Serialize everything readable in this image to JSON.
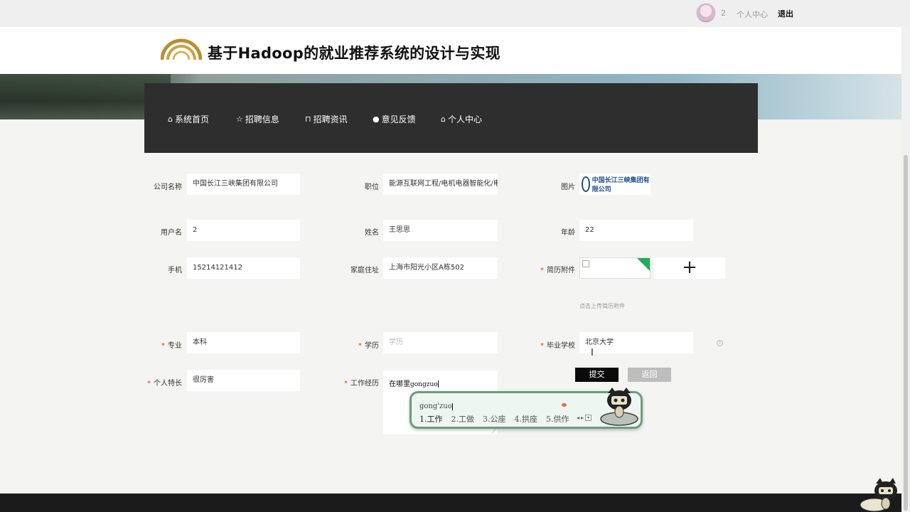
{
  "topbar": {
    "username": "2",
    "personal_center": "个人中心",
    "logout": "退出"
  },
  "header": {
    "title": "基于Hadoop的就业推荐系统的设计与实现"
  },
  "nav": {
    "items": [
      {
        "label": "系统首页",
        "icon": "home-icon"
      },
      {
        "label": "招聘信息",
        "icon": "star-icon"
      },
      {
        "label": "招聘资讯",
        "icon": "bag-icon"
      },
      {
        "label": "意见反馈",
        "icon": "alert-circle-icon"
      },
      {
        "label": "个人中心",
        "icon": "home-icon"
      }
    ]
  },
  "form": {
    "company_name_label": "公司名称",
    "company_name": "中国长江三峡集团有限公司",
    "position_label": "职位",
    "position": "能源互联网工程/电机电器智能化/电",
    "image_label": "图片",
    "company_logo_text": "中国长江三峡集团有限公司",
    "username_label": "用户名",
    "username": "2",
    "name_label": "姓名",
    "name": "王思思",
    "age_label": "年龄",
    "age": "22",
    "phone_label": "手机",
    "phone": "15214121412",
    "address_label": "家庭住址",
    "address": "上海市阳光小区A栋502",
    "resume_label": "简历附件",
    "upload_hint": "点击上传简历附件",
    "major_label": "专业",
    "major": "本科",
    "education_label": "学历",
    "education_placeholder": "学历",
    "school_label": "毕业学校",
    "school": "北京大学",
    "specialty_label": "个人特长",
    "specialty": "很厉害",
    "experience_label": "工作经历",
    "experience_text": "在哪里",
    "experience_composing": "gongzuo",
    "submit": "提交",
    "back": "返回"
  },
  "ime": {
    "pinyin": "gong'zuo",
    "candidates": [
      "1.工作",
      "2.工做",
      "3.公座",
      "4.拱座",
      "5.供作"
    ]
  },
  "colors": {
    "nav_bg": "#2e2e2e",
    "submit_bg": "#0b0b0b",
    "back_bg": "#bdbdbd",
    "required": "#e5392b"
  }
}
